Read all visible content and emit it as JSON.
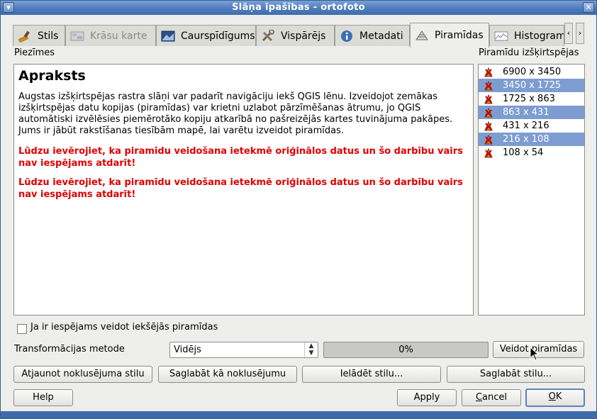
{
  "window": {
    "title": "Slāņa īpašības - ortofoto",
    "menu_icon": "down-arrow-icon",
    "close_icon": "close-icon"
  },
  "tabs": [
    {
      "label": "Stils",
      "icon": "brush-icon",
      "state": "normal"
    },
    {
      "label": "Krāsu karte",
      "icon": "colormap-icon",
      "state": "disabled"
    },
    {
      "label": "Caurspīdīgums",
      "icon": "transparency-icon",
      "state": "normal"
    },
    {
      "label": "Vispārējs",
      "icon": "tools-icon",
      "state": "normal"
    },
    {
      "label": "Metadati",
      "icon": "info-icon",
      "state": "normal"
    },
    {
      "label": "Piramīdas",
      "icon": "pyramid-icon",
      "state": "active"
    },
    {
      "label": "Histogram",
      "icon": "histogram-icon",
      "state": "normal"
    }
  ],
  "tab_scroll": {
    "left": "‹",
    "right": "›"
  },
  "notes": {
    "section_label": "Piezīmes",
    "heading": "Apraksts",
    "description": "Augstas izšķirtspējas rastra slāņi var padarīt navigāciju iekš QGIS lēnu. Izveidojot zemākas izšķirtspējas datu kopijas (piramīdas) var krietni uzlabot pārzīmēšanas ātrumu, jo QGIS automātiski izvēlēsies piemērotāko kopiju atkarībā no pašreizējās kartes tuvinājuma pakāpes. Jums ir jābūt rakstīšanas tiesībām mapē, lai varētu izveidot piramīdas.",
    "warning_1": "Lūdzu ievērojiet, ka piramīdu veidošana ietekmē oriģinālos datus un šo darbību vairs nav iespējams atdarīt!",
    "warning_2": "Lūdzu ievērojiet, ka piramīdu veidošana ietekmē oriģinālos datus un šo darbību vairs nav iespējams atdarīt!",
    "warning_color": "#e00000"
  },
  "pyramids": {
    "label": "Piramīdu izšķirtspējas",
    "items": [
      {
        "label": "6900 x 3450",
        "selected": false
      },
      {
        "label": "3450 x 1725",
        "selected": true
      },
      {
        "label": "1725 x 863",
        "selected": false
      },
      {
        "label": "863 x 431",
        "selected": true
      },
      {
        "label": "431 x 216",
        "selected": false
      },
      {
        "label": "216 x 108",
        "selected": true
      },
      {
        "label": "108 x 54",
        "selected": false
      }
    ],
    "selection_color": "#7d9dd1"
  },
  "internal_pyramids": {
    "label": "Ja ir iespējams veidot iekšējās piramīdas",
    "checked": false
  },
  "transform": {
    "label": "Transformācijas metode",
    "selected": "Vidējs",
    "progress_value": 0,
    "progress_text": "0%",
    "build_button": "Veidot piramīdas"
  },
  "style_buttons": {
    "restore_default": "Atjaunot noklusējuma stilu",
    "save_as_default": "Saglabāt kā noklusējumu",
    "load_style": "Ielādēt stilu...",
    "save_style": "Saglabāt stilu..."
  },
  "dialog_buttons": {
    "help": "Help",
    "apply": "Apply",
    "cancel": "Cancel",
    "ok": "OK"
  }
}
